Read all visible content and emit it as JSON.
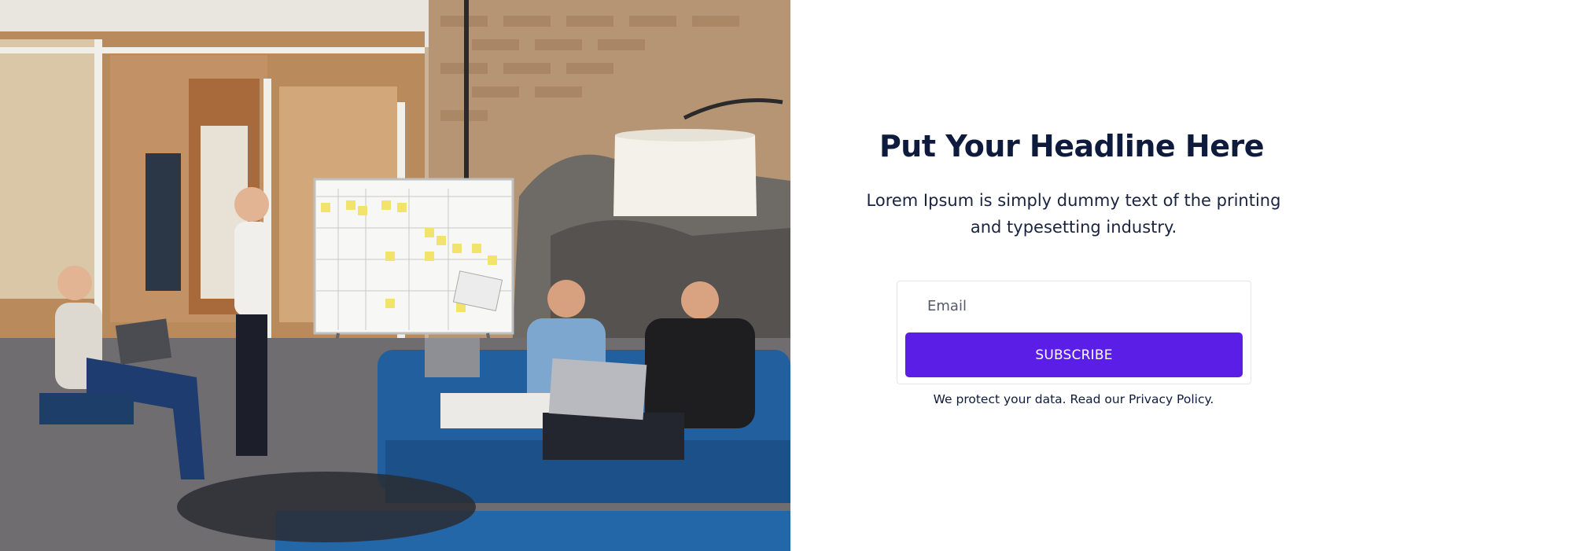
{
  "hero": {
    "image_alt": "Team meeting in an office with a whiteboard, laptops and a blue sofa"
  },
  "content": {
    "headline": "Put Your Headline Here",
    "description": "Lorem Ipsum is simply dummy text of the printing and typesetting industry."
  },
  "form": {
    "email_placeholder": "Email",
    "subscribe_label": "SUBSCRIBE"
  },
  "privacy": {
    "prefix": "We protect your data. Read our ",
    "link_label": "Privacy Policy."
  },
  "colors": {
    "headline": "#0f1b3d",
    "button_bg": "#5a1ee6",
    "button_text": "#ffffff",
    "card_border": "#e4e6ec"
  }
}
